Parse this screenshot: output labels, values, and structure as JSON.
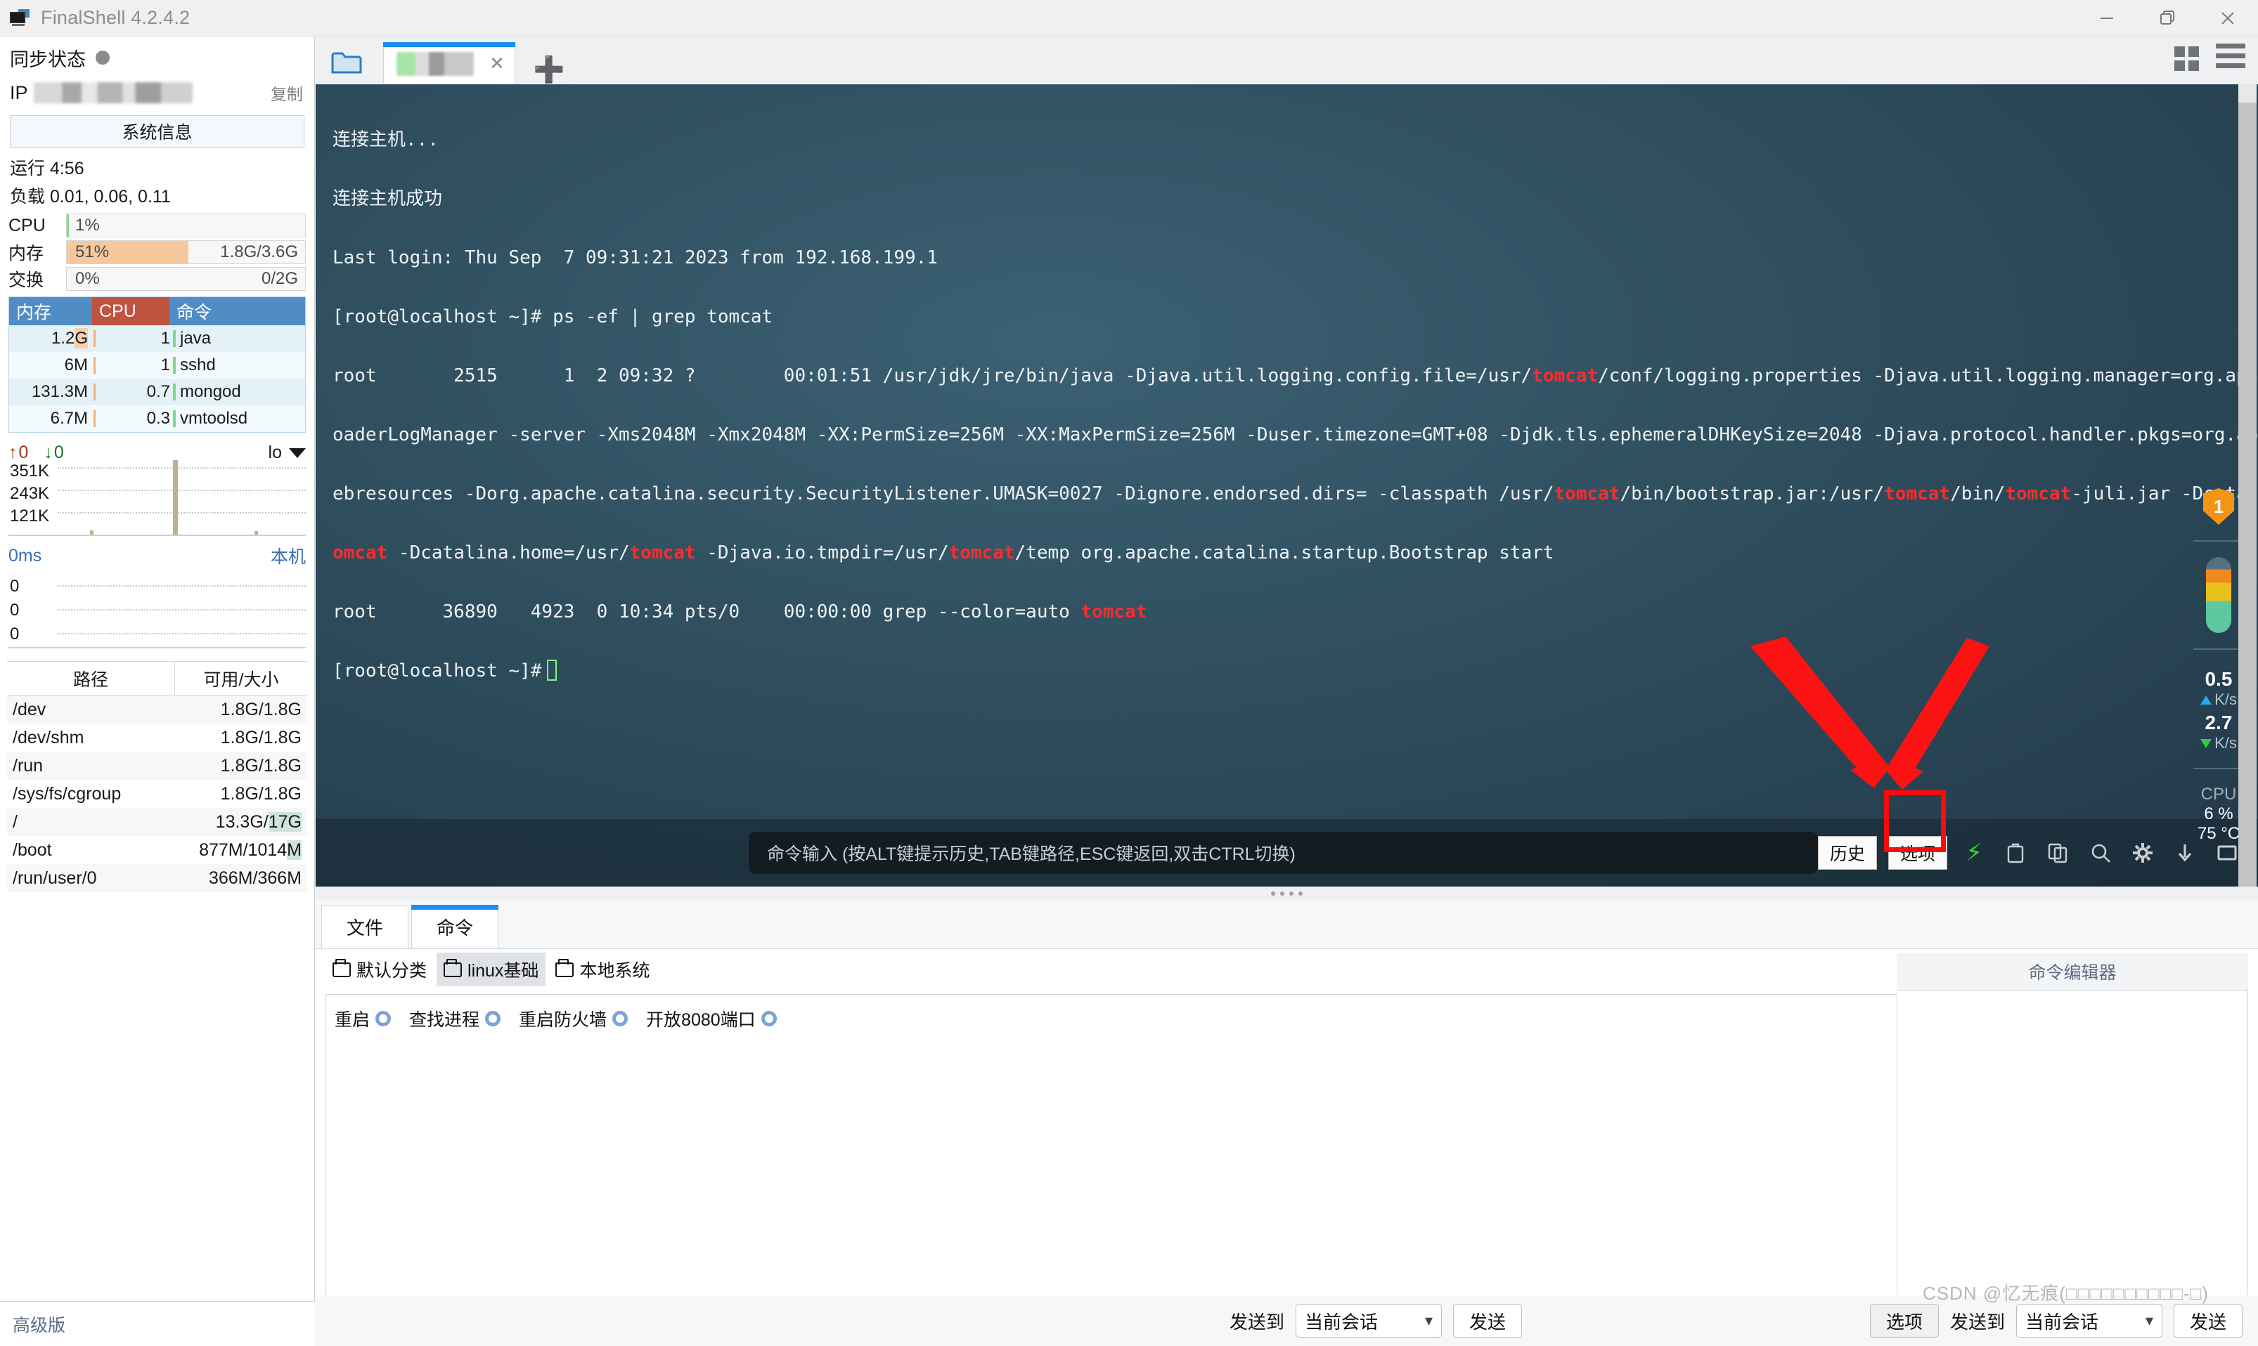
{
  "window": {
    "title": "FinalShell 4.2.4.2",
    "minimize_icon": "minimize-icon",
    "restore_icon": "restore-icon",
    "close_icon": "close-icon"
  },
  "sidebar": {
    "sync_label": "同步状态",
    "ip_label": "IP",
    "copy_label": "复制",
    "sysinfo_button": "系统信息",
    "uptime": "运行 4:56",
    "load": "负载 0.01, 0.06, 0.11",
    "meters": [
      {
        "name": "CPU",
        "pct": "1%",
        "fill": 1,
        "value": "",
        "color": "#7ddc86"
      },
      {
        "name": "内存",
        "pct": "51%",
        "fill": 51,
        "value": "1.8G/3.6G",
        "color": "#f7c89e"
      },
      {
        "name": "交换",
        "pct": "0%",
        "fill": 0,
        "value": "0/2G",
        "color": "#f7c89e"
      }
    ],
    "process_table": {
      "headers": {
        "mem": "内存",
        "cpu": "CPU",
        "cmd": "命令"
      },
      "rows": [
        {
          "mem": "1.2G",
          "mem_hl": "G",
          "cpu": "1",
          "cmd": "java"
        },
        {
          "mem": "6M",
          "mem_hl": "",
          "cpu": "1",
          "cmd": "sshd"
        },
        {
          "mem": "131.3M",
          "mem_hl": "",
          "cpu": "0.7",
          "cmd": "mongod"
        },
        {
          "mem": "6.7M",
          "mem_hl": "",
          "cpu": "0.3",
          "cmd": "vmtoolsd"
        }
      ]
    },
    "net": {
      "up_value": "0",
      "down_value": "0",
      "interface": "lo",
      "axis": [
        "351K",
        "243K",
        "121K"
      ]
    },
    "latency": {
      "value": "0ms",
      "host": "本机",
      "axis": [
        "0",
        "0",
        "0"
      ]
    },
    "disk_table": {
      "headers": {
        "path": "路径",
        "size": "可用/大小"
      },
      "rows": [
        {
          "path": "/dev",
          "size": "1.8G/1.8G",
          "hl": ""
        },
        {
          "path": "/dev/shm",
          "size": "1.8G/1.8G",
          "hl": ""
        },
        {
          "path": "/run",
          "size": "1.8G/1.8G",
          "hl": ""
        },
        {
          "path": "/sys/fs/cgroup",
          "size": "1.8G/1.8G",
          "hl": ""
        },
        {
          "path": "/",
          "size": "13.3G/17G",
          "hl": "17G"
        },
        {
          "path": "/boot",
          "size": "877M/1014M",
          "hl": "M"
        },
        {
          "path": "/run/user/0",
          "size": "366M/366M",
          "hl": ""
        }
      ]
    },
    "advanced_label": "高级版"
  },
  "tabstrip": {
    "folder_icon": "folder-icon",
    "close_icon": "close-icon",
    "new_tab_icon": "plus-icon",
    "grid_icon": "grid-view-icon",
    "menu_icon": "hamburger-menu-icon"
  },
  "terminal": {
    "lines": [
      {
        "text": "连接主机..."
      },
      {
        "text": "连接主机成功"
      },
      {
        "text": "Last login: Thu Sep  7 09:31:21 2023 from 192.168.199.1"
      },
      {
        "text": "[root@localhost ~]# ps -ef | grep tomcat"
      },
      {
        "text": "root       2515      1  2 09:32 ?        00:01:51 /usr/jdk/jre/bin/java -Djava.util.logging.config.file=/usr/tomcat/conf/logging.properties -Djava.util.logging.manager=org.apache.juli.ClassL"
      },
      {
        "text": "oaderLogManager -server -Xms2048M -Xmx2048M -XX:PermSize=256M -XX:MaxPermSize=256M -Duser.timezone=GMT+08 -Djdk.tls.ephemeralDHKeySize=2048 -Djava.protocol.handler.pkgs=org.apache.catalina.w"
      },
      {
        "text": "ebresources -Dorg.apache.catalina.security.SecurityListener.UMASK=0027 -Dignore.endorsed.dirs= -classpath /usr/tomcat/bin/bootstrap.jar:/usr/tomcat/bin/tomcat-juli.jar -Dcatalina.base=/usr/t"
      },
      {
        "text": "omcat -Dcatalina.home=/usr/tomcat -Djava.io.tmpdir=/usr/tomcat/temp org.apache.catalina.startup.Bootstrap start"
      },
      {
        "text": "root      36890   4923  0 10:34 pts/0    00:00:00 grep --color=auto tomcat"
      },
      {
        "text": "[root@localhost ~]# "
      }
    ],
    "highlight_word": "tomcat",
    "highlight_color": "#ff2b2b"
  },
  "gauges": {
    "badge_count": "1",
    "net_up": "0.5",
    "net_up_unit": "K/s",
    "net_down": "2.7",
    "net_down_unit": "K/s",
    "cpu_label": "CPU",
    "cpu_pct": "6 %",
    "cpu_temp": "75 °C"
  },
  "command_bar": {
    "placeholder": "命令输入 (按ALT键提示历史,TAB键路径,ESC键返回,双击CTRL切换)",
    "history_button": "历史",
    "options_button": "选项",
    "icons": [
      "lightning-icon",
      "paste-icon",
      "copy-icon",
      "search-icon",
      "gear-icon",
      "download-icon",
      "window-icon"
    ]
  },
  "bottom_panel": {
    "tabs": [
      {
        "label": "文件",
        "active": false
      },
      {
        "label": "命令",
        "active": true
      }
    ],
    "categories": [
      {
        "label": "默认分类",
        "active": false
      },
      {
        "label": "linux基础",
        "active": true
      },
      {
        "label": "本地系统",
        "active": false
      }
    ],
    "commands": [
      {
        "label": "重启"
      },
      {
        "label": "查找进程"
      },
      {
        "label": "重启防火墙"
      },
      {
        "label": "开放8080端口"
      }
    ],
    "editor_title": "命令编辑器",
    "editor_value": ""
  },
  "action_bar": {
    "send_to_label": "发送到",
    "target_value": "当前会话",
    "send_button": "发送",
    "options_button": "选项",
    "right_send_to_label": "发送到",
    "right_target_value": "当前会话",
    "right_send_button": "发送"
  },
  "watermark": "CSDN @忆无痕(□□□□□□□□□□-□)",
  "colors": {
    "accent": "#1b8ef2",
    "terminal_bg": "#2f4e5e",
    "highlight_red": "#ff2b2b",
    "mem_bar": "#f7c89e",
    "cpu_bar": "#7ddc86",
    "header_blue": "#4f8dc4",
    "header_red": "#bf5340",
    "annotation_red": "#fb0b0b"
  }
}
